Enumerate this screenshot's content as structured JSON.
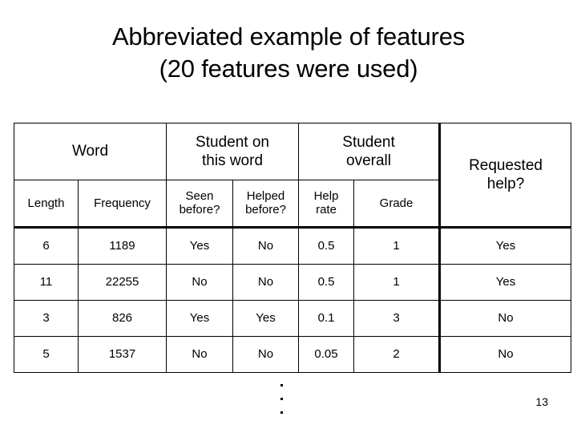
{
  "slide": {
    "title_line1": "Abbreviated example of features",
    "title_line2": "(20 features were used)",
    "slide_number": "13",
    "continuation_marker": "vertical-ellipsis"
  },
  "table": {
    "group_headers": [
      {
        "key": "word",
        "label": "Word",
        "span": 2
      },
      {
        "key": "student_on_this_word",
        "label": "Student on this word",
        "span": 2
      },
      {
        "key": "student_overall",
        "label": "Student overall",
        "span": 2
      },
      {
        "key": "requested_help",
        "label": "Requested help?",
        "span": 1,
        "rowspan": 2
      }
    ],
    "group_header_lines": {
      "word": [
        "Word"
      ],
      "student_on_this_word": [
        "Student on",
        "this word"
      ],
      "student_overall": [
        "Student",
        "overall"
      ],
      "requested_help": [
        "Requested",
        "help?"
      ]
    },
    "sub_headers": [
      {
        "key": "length",
        "label": "Length",
        "lines": [
          "Length"
        ]
      },
      {
        "key": "frequency",
        "label": "Frequency",
        "lines": [
          "Frequency"
        ]
      },
      {
        "key": "seen_before",
        "label": "Seen before?",
        "lines": [
          "Seen",
          "before?"
        ]
      },
      {
        "key": "helped_before",
        "label": "Helped before?",
        "lines": [
          "Helped",
          "before?"
        ]
      },
      {
        "key": "help_rate",
        "label": "Help rate",
        "lines": [
          "Help",
          "rate"
        ]
      },
      {
        "key": "grade",
        "label": "Grade",
        "lines": [
          "Grade"
        ]
      }
    ],
    "rows": [
      {
        "length": "6",
        "frequency": "1189",
        "seen_before": "Yes",
        "helped_before": "No",
        "help_rate": "0.5",
        "grade": "1",
        "requested_help": "Yes"
      },
      {
        "length": "11",
        "frequency": "22255",
        "seen_before": "No",
        "helped_before": "No",
        "help_rate": "0.5",
        "grade": "1",
        "requested_help": "Yes"
      },
      {
        "length": "3",
        "frequency": "826",
        "seen_before": "Yes",
        "helped_before": "Yes",
        "help_rate": "0.1",
        "grade": "3",
        "requested_help": "No"
      },
      {
        "length": "5",
        "frequency": "1537",
        "seen_before": "No",
        "helped_before": "No",
        "help_rate": "0.05",
        "grade": "2",
        "requested_help": "No"
      }
    ]
  },
  "colors": {
    "background": "#ffffff",
    "text": "#000000",
    "border": "#000000"
  }
}
